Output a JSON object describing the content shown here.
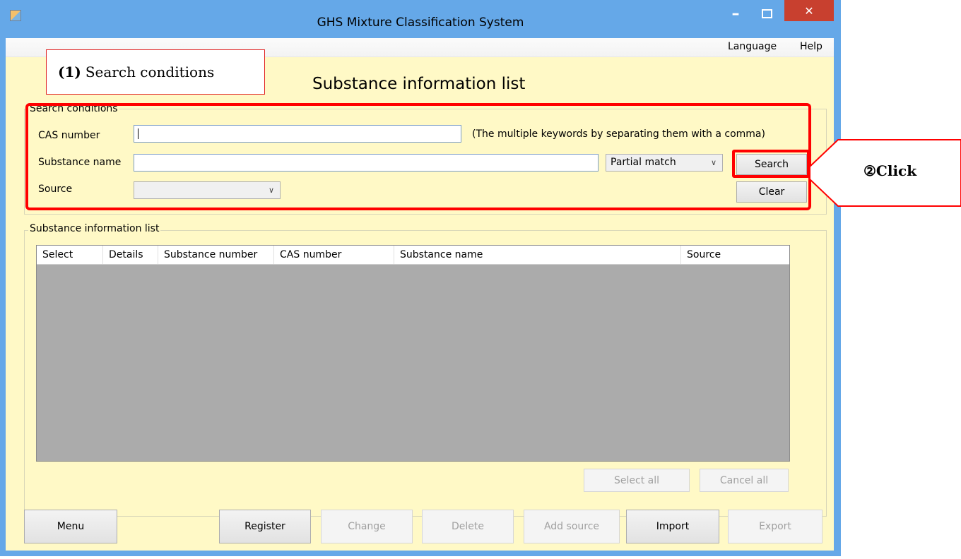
{
  "window": {
    "title": "GHS Mixture Classification System",
    "min_symbol": "–",
    "close_symbol": "✕"
  },
  "menu": {
    "language": "Language",
    "help": "Help"
  },
  "page_title": "Substance information list",
  "search": {
    "legend": "Search conditions",
    "cas_label": "CAS number",
    "cas_value": "",
    "hint": "(The multiple keywords by separating them with a comma)",
    "name_label": "Substance name",
    "name_value": "",
    "match_mode": "Partial match",
    "source_label": "Source",
    "source_value": "",
    "search_button": "Search",
    "clear_button": "Clear"
  },
  "list": {
    "legend": "Substance information list",
    "columns": [
      "Select",
      "Details",
      "Substance number",
      "CAS number",
      "Substance name",
      "Source"
    ],
    "rows": [],
    "select_all": "Select all",
    "cancel_all": "Cancel all"
  },
  "bottom_buttons": {
    "menu": "Menu",
    "register": "Register",
    "change": "Change",
    "delete": "Delete",
    "add_source": "Add source",
    "import": "Import",
    "export": "Export"
  },
  "annotations": {
    "step1_number": "(1)",
    "step1_text": "Search conditions",
    "step2": "②Click"
  },
  "colors": {
    "title_bar": "#65a8e8",
    "client_bg": "#fff9c6",
    "grid_bg": "#ababab",
    "highlight": "#ff0000",
    "close_button": "#c8402f"
  }
}
